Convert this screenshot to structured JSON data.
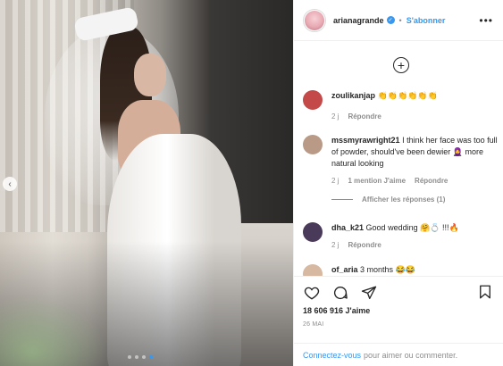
{
  "post": {
    "username": "arianagrande",
    "follow_label": "S'abonner",
    "separator": "•",
    "more_label": "•••",
    "verified_glyph": "✓",
    "likes": "18 606 916 J'aime",
    "date": "26 MAI",
    "login_link": "Connectez-vous",
    "login_text": "pour aimer ou commenter.",
    "load_more_glyph": "+"
  },
  "comments": [
    {
      "user": "zoulikanjap",
      "text": "👏👏👏👏👏👏",
      "time": "2 j",
      "reply": "Répondre",
      "avatar_color": "#c44a4a"
    },
    {
      "user": "mssmyrawright21",
      "text": "I think her face was too full of powder, should've been dewier 🧕 more natural looking",
      "time": "2 j",
      "mentions": "1 mention J'aime",
      "reply": "Répondre",
      "view_replies": "Afficher les réponses (1)",
      "avatar_color": "#b89a86"
    },
    {
      "user": "dha_k21",
      "text": "Good wedding 🤗💍 !!!🔥",
      "time": "2 j",
      "reply": "Répondre",
      "avatar_color": "#4a3a5a"
    },
    {
      "user": "of_aria",
      "text": "3 months 😂😂",
      "avatar_color": "#d7b8a0"
    }
  ],
  "icons": {
    "heart": "heart-icon",
    "comment": "comment-icon",
    "share": "share-icon",
    "bookmark": "bookmark-icon",
    "prev": "chevron-left-icon"
  },
  "carousel": {
    "prev_glyph": "‹",
    "count": 4,
    "active_index": 3
  },
  "colors": {
    "accent": "#3897f0",
    "text": "#262626",
    "muted": "#8e8e8e",
    "border": "#efefef"
  }
}
